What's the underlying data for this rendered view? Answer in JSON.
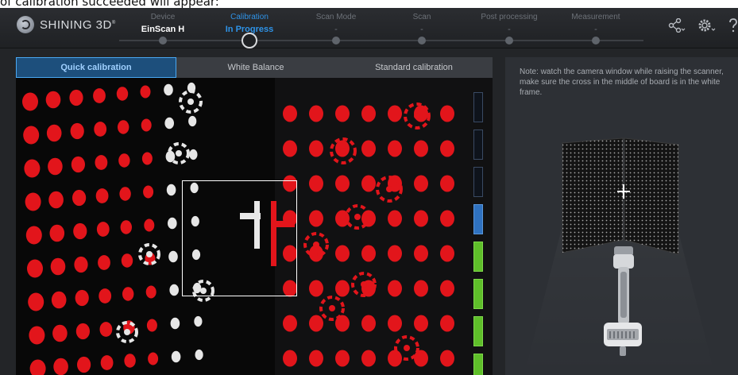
{
  "doc_caption": "of calibration succeeded will appear:",
  "brand": {
    "name": "SHINING 3D",
    "trademark": "®"
  },
  "workflow": {
    "steps": [
      {
        "label": "Device",
        "value": "EinScan H",
        "state": "done"
      },
      {
        "label": "Calibration",
        "value": "In Progress",
        "state": "active"
      },
      {
        "label": "Scan Mode",
        "value": "-",
        "state": "pending"
      },
      {
        "label": "Scan",
        "value": "-",
        "state": "pending"
      },
      {
        "label": "Post processing",
        "value": "-",
        "state": "pending"
      },
      {
        "label": "Measurement",
        "value": "-",
        "state": "pending"
      }
    ]
  },
  "toolbar_icons": [
    "share-icon",
    "settings-icon",
    "help-icon"
  ],
  "tabs": {
    "quick": "Quick calibration",
    "white": "White Balance",
    "standard": "Standard calibration",
    "active": "Quick calibration"
  },
  "distance_meter": {
    "levels": [
      "empty",
      "empty",
      "empty",
      "blue",
      "green",
      "green",
      "green",
      "green"
    ]
  },
  "note": "Note: watch the camera window while raising the scanner, make sure the cross in the middle of board is in the white frame.",
  "colors": {
    "accent": "#2e93e8",
    "target_red": "#e2151b",
    "meter_blue": "#2f72c0",
    "meter_green": "#5fbf2a"
  }
}
